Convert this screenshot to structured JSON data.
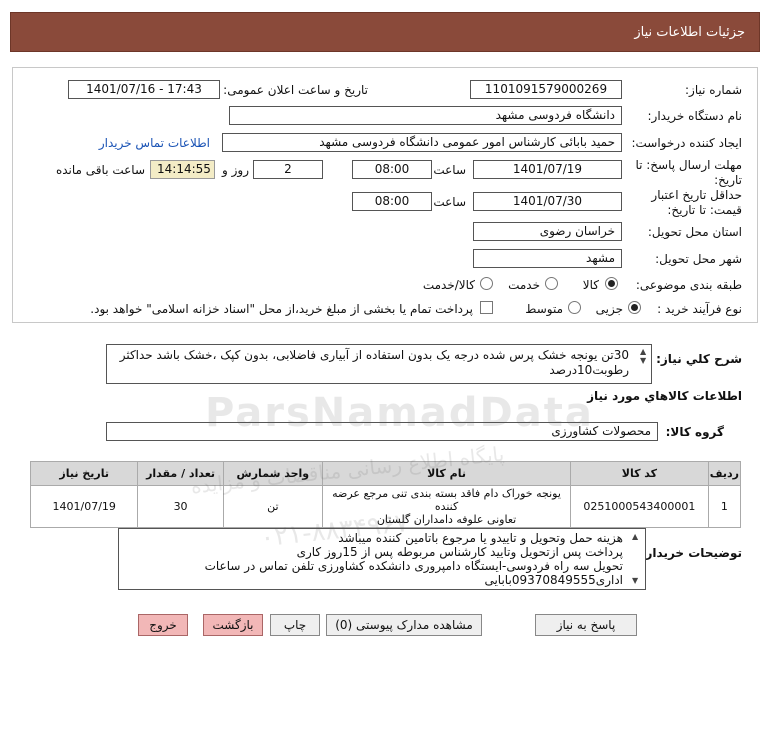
{
  "header": {
    "title": "جزئیات اطلاعات نیاز"
  },
  "form": {
    "need_number": {
      "label": "شماره نیاز:",
      "value": "1101091579000269"
    },
    "announce_datetime": {
      "label": "تاریخ و ساعت اعلان عمومی:",
      "value": "1401/07/16 - 17:43"
    },
    "buyer_org": {
      "label": "نام دستگاه خریدار:",
      "value": "دانشگاه فردوسی مشهد"
    },
    "requester": {
      "label": "ایجاد کننده درخواست:",
      "value": "حمید بابائی کارشناس امور عمومی دانشگاه فردوسی مشهد",
      "contact_link": "اطلاعات تماس خریدار"
    },
    "reply_deadline": {
      "label_line1": "مهلت ارسال پاسخ: تا",
      "label_line2": "تاریخ:",
      "date": "1401/07/19",
      "time_label": "ساعت",
      "time": "08:00",
      "days": "2",
      "days_label": "روز و",
      "remaining": "14:14:55",
      "remaining_label": "ساعت باقی مانده"
    },
    "price_validity": {
      "label_line1": "حداقل تاریخ اعتبار",
      "label_line2": "قیمت: تا تاریخ:",
      "date": "1401/07/30",
      "time_label": "ساعت",
      "time": "08:00"
    },
    "delivery_province": {
      "label": "استان محل تحویل:",
      "value": "خراسان رضوی"
    },
    "delivery_city": {
      "label": "شهر محل تحویل:",
      "value": "مشهد"
    },
    "category": {
      "label": "طبقه بندی موضوعی:",
      "options": [
        "کالا",
        "خدمت",
        "کالا/خدمت"
      ],
      "selected": "کالا"
    },
    "purchase_type": {
      "label": "نوع فرآیند خرید :",
      "options": [
        "جزیی",
        "متوسط"
      ],
      "selected": "جزیی",
      "treasury_note": "پرداخت تمام یا بخشی از مبلغ خرید،از محل \"اسناد خزانه اسلامی\" خواهد بود."
    }
  },
  "summary": {
    "label": "شرح کلي نياز:",
    "text": "30تن یونجه خشک پرس شده درجه یک بدون استفاده از آبیاری فاضلابی، بدون کپک ،خشک باشد حداکثر رطوبت10درصد"
  },
  "goods_info": {
    "title": "اطلاعات کالاهاي مورد نياز"
  },
  "goods_group": {
    "label": "گروه کالا:",
    "value": "محصولات کشاورزی"
  },
  "table": {
    "headers": [
      "ردیف",
      "کد کالا",
      "نام کالا",
      "واحد شمارش",
      "تعداد / مقدار",
      "تاریخ نیاز"
    ],
    "rows": [
      {
        "row": "1",
        "code": "0251000543400001",
        "name_line1": "یونجه خوراک دام فاقد بسته بندی تنی مرجع عرضه کننده",
        "name_line2": "تعاونی علوفه دامداران گلستان",
        "unit": "تن",
        "qty": "30",
        "date": "1401/07/19"
      }
    ]
  },
  "buyer_notes": {
    "label": "توضیحات خریدار:",
    "lines": [
      "هزینه حمل وتحویل و تاییدو یا مرجوع باتامین کننده میباشد",
      "پرداخت پس ازتحویل وتایید کارشناس مربوطه پس از 15روز کاری",
      "تحویل سه راه فردوسی-ایستگاه دامپروری دانشکده کشاورزی تلفن تماس در ساعات",
      "اداری09370849555بابایی"
    ]
  },
  "buttons": {
    "reply": "پاسخ به نیاز",
    "attachments": "مشاهده مدارک پیوستی (0)",
    "print": "چاپ",
    "back": "بازگشت",
    "exit": "خروج"
  },
  "watermark": {
    "brand": "ParsNamadData",
    "line_fa": "پایگاه اطلاع رسانی مناقصات و مزایده",
    "phone": "۰۲۱-۸۸۳۴۹۶۷۰"
  },
  "colors": {
    "header_bg": "#8a4a3a",
    "link": "#1a53b5",
    "remaining_bg": "#f3ecc6",
    "button_red": "#f2b7b7"
  }
}
